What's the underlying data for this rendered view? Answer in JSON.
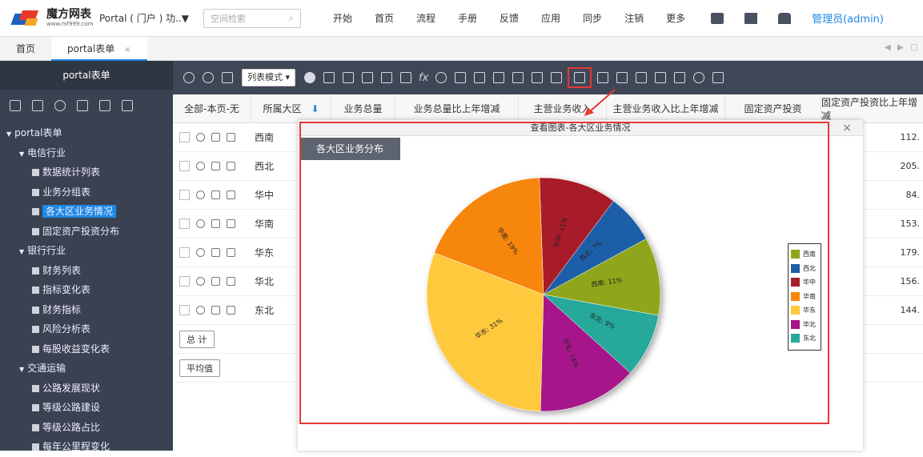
{
  "topbar": {
    "logo_name": "魔方网表",
    "logo_url": "www.mf999.com",
    "portal_selector": "Portal ( 门户 ) 功..▼",
    "search_placeholder": "空间检索",
    "nav": [
      "开始",
      "首页",
      "流程",
      "手册",
      "反馈",
      "应用",
      "同步",
      "注销",
      "更多"
    ],
    "admin": "管理员(admin)"
  },
  "tabs": [
    {
      "label": "首页"
    },
    {
      "label": "portal表单",
      "close": "×"
    }
  ],
  "sidebar": {
    "title": "portal表单",
    "tree": [
      {
        "level": 0,
        "label": "portal表单",
        "type": "folder"
      },
      {
        "level": 1,
        "label": "电信行业",
        "type": "folder"
      },
      {
        "level": 2,
        "label": "数据统计列表",
        "type": "form"
      },
      {
        "level": 2,
        "label": "业务分组表",
        "type": "form"
      },
      {
        "level": 2,
        "label": "各大区业务情况",
        "type": "form",
        "selected": true
      },
      {
        "level": 2,
        "label": "固定资产投资分布",
        "type": "form"
      },
      {
        "level": 1,
        "label": "银行行业",
        "type": "folder"
      },
      {
        "level": 2,
        "label": "财务列表",
        "type": "form"
      },
      {
        "level": 2,
        "label": "指标变化表",
        "type": "form"
      },
      {
        "level": 2,
        "label": "财务指标",
        "type": "form"
      },
      {
        "level": 2,
        "label": "风险分析表",
        "type": "form"
      },
      {
        "level": 2,
        "label": "每股收益变化表",
        "type": "form"
      },
      {
        "level": 1,
        "label": "交通运输",
        "type": "folder"
      },
      {
        "level": 2,
        "label": "公路发展现状",
        "type": "form"
      },
      {
        "level": 2,
        "label": "等级公路建设",
        "type": "form"
      },
      {
        "level": 2,
        "label": "等级公路占比",
        "type": "form"
      },
      {
        "level": 2,
        "label": "每年公里程变化",
        "type": "form"
      }
    ]
  },
  "toolbar": {
    "view_mode": "列表模式 ▾",
    "fx": "fx"
  },
  "grid": {
    "headers": [
      "全部-本页-无",
      "所属大区",
      "业务总量",
      "业务总量比上年增减",
      "主营业务收入",
      "主营业务收入比上年增减",
      "固定资产投资",
      "固定资产投资比上年增减"
    ],
    "rows": [
      {
        "region": "西南",
        "last": "112."
      },
      {
        "region": "西北",
        "last": "205."
      },
      {
        "region": "华中",
        "last": "84."
      },
      {
        "region": "华南",
        "last": "153."
      },
      {
        "region": "华东",
        "last": "179."
      },
      {
        "region": "华北",
        "last": "156."
      },
      {
        "region": "东北",
        "last": "144."
      }
    ],
    "total_button": "总 计",
    "average_button": "平均值"
  },
  "dialog": {
    "title": "查看图表-各大区业务情况",
    "close": "×",
    "chart_tab": "各大区业务分布"
  },
  "chart_data": {
    "type": "pie",
    "title": "",
    "slices": [
      {
        "name": "西南",
        "value": 11,
        "color": "#8fa61a"
      },
      {
        "name": "西北",
        "value": 7,
        "color": "#1f5fa8"
      },
      {
        "name": "华中",
        "value": 11,
        "color": "#a81e2a"
      },
      {
        "name": "华南",
        "value": 19,
        "color": "#f7860b"
      },
      {
        "name": "华东",
        "value": 31,
        "color": "#ffc93c"
      },
      {
        "name": "华北",
        "value": 14,
        "color": "#a6178a"
      },
      {
        "name": "东北",
        "value": 9,
        "color": "#27a89a"
      }
    ],
    "data_labels": [
      "西南: 11%",
      "西北: 7%",
      "华中: 11%",
      "华南: 19%",
      "华东: 31%",
      "华北: 14%",
      "东北: 9%"
    ],
    "legend_position": "right"
  },
  "colors": {
    "accent": "#1e88e5",
    "sidebar_bg": "#3a4150",
    "toolbar_bg": "#3f4656",
    "highlight": "#e53935"
  }
}
